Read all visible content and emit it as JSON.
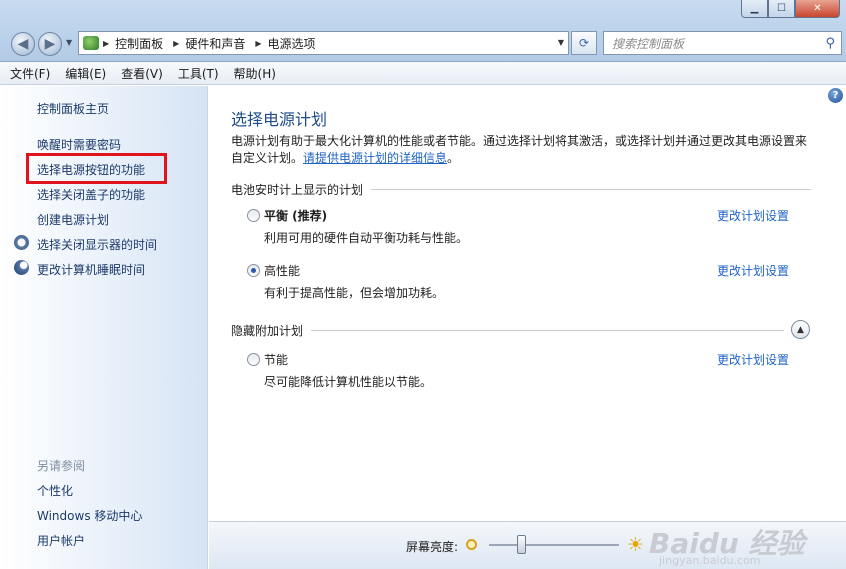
{
  "window": {
    "minimize": "▁",
    "maximize": "☐",
    "close": "✕"
  },
  "nav": {
    "back": "◀",
    "forward": "▶"
  },
  "address": {
    "crumbs": [
      "控制面板",
      "硬件和声音",
      "电源选项"
    ]
  },
  "search": {
    "placeholder": "搜索控制面板"
  },
  "menu": [
    "文件(F)",
    "编辑(E)",
    "查看(V)",
    "工具(T)",
    "帮助(H)"
  ],
  "sidebar": {
    "home": "控制面板主页",
    "items": [
      "唤醒时需要密码",
      "选择电源按钮的功能",
      "选择关闭盖子的功能",
      "创建电源计划",
      "选择关闭显示器的时间",
      "更改计算机睡眠时间"
    ],
    "see_also_title": "另请参阅",
    "see_also": [
      "个性化",
      "Windows 移动中心",
      "用户帐户"
    ]
  },
  "main": {
    "title": "选择电源计划",
    "description": "电源计划有助于最大化计算机的性能或者节能。通过选择计划将其激活，或选择计划并通过更改其电源设置来自定义计划。",
    "description_link": "请提供电源计划的详细信息",
    "group1": "电池安时计上显示的计划",
    "group2": "隐藏附加计划",
    "plans": [
      {
        "name": "平衡 (推荐)",
        "desc": "利用可用的硬件自动平衡功耗与性能。",
        "selected": false,
        "change": "更改计划设置"
      },
      {
        "name": "高性能",
        "desc": "有利于提高性能，但会增加功耗。",
        "selected": true,
        "change": "更改计划设置"
      },
      {
        "name": "节能",
        "desc": "尽可能降低计算机性能以节能。",
        "selected": false,
        "change": "更改计划设置"
      }
    ]
  },
  "bottom": {
    "brightness_label": "屏幕亮度:",
    "brightness_level": 0.25
  },
  "watermark": {
    "brand": "Baidu 经验",
    "url": "jingyan.baidu.com"
  }
}
